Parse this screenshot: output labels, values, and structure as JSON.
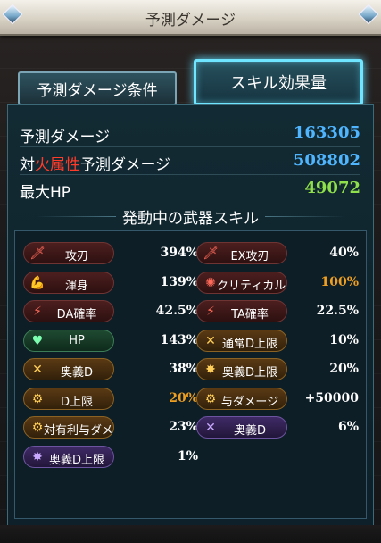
{
  "header": {
    "title": "予測ダメージ"
  },
  "tabs": [
    {
      "label": "予測ダメージ条件",
      "active": false
    },
    {
      "label": "スキル効果量",
      "active": true
    }
  ],
  "stats": {
    "predicted_damage": {
      "label": "予測ダメージ",
      "value": "163305",
      "color": "#4fb5ff"
    },
    "fire_damage": {
      "prefix": "対",
      "element": "火属性",
      "suffix": "予測ダメージ",
      "value": "508802",
      "color": "#4fb5ff"
    },
    "max_hp": {
      "label": "最大HP",
      "value": "49072",
      "color": "#8fe04a"
    }
  },
  "section_title": "発動中の武器スキル",
  "skills_left": [
    {
      "name": "攻刃",
      "value": "394%",
      "style": "red",
      "icon": "sword-icon",
      "glyph": "🗡"
    },
    {
      "name": "渾身",
      "value": "139%",
      "style": "red",
      "icon": "muscle-icon",
      "glyph": "💪"
    },
    {
      "name": "DA確率",
      "value": "42.5%",
      "style": "red",
      "icon": "double-slash-icon",
      "glyph": "⚡"
    },
    {
      "name": "HP",
      "value": "143%",
      "style": "green",
      "icon": "heart-icon",
      "glyph": "♥"
    },
    {
      "name": "奥義D",
      "value": "38%",
      "style": "orange",
      "icon": "crossed-swords-icon",
      "glyph": "✕"
    },
    {
      "name": "D上限",
      "value": "20%",
      "style": "orange",
      "icon": "gear-icon",
      "glyph": "⚙",
      "value_color": "orange"
    },
    {
      "name": "対有利与ダメ",
      "value": "23%",
      "style": "orange",
      "icon": "gear-icon",
      "glyph": "⚙"
    },
    {
      "name": "奥義D上限",
      "value": "1%",
      "style": "purple",
      "icon": "burst-icon",
      "glyph": "✸"
    }
  ],
  "skills_right": [
    {
      "name": "EX攻刃",
      "value": "40%",
      "style": "red",
      "icon": "sword-icon",
      "glyph": "🗡"
    },
    {
      "name": "クリティカル",
      "value": "100%",
      "style": "red",
      "icon": "crit-star-icon",
      "glyph": "✺",
      "value_color": "orange"
    },
    {
      "name": "TA確率",
      "value": "22.5%",
      "style": "red",
      "icon": "triple-slash-icon",
      "glyph": "⚡"
    },
    {
      "name": "通常D上限",
      "value": "10%",
      "style": "orange",
      "icon": "crossed-swords-icon",
      "glyph": "✕"
    },
    {
      "name": "奥義D上限",
      "value": "20%",
      "style": "orange",
      "icon": "burst-icon",
      "glyph": "✸"
    },
    {
      "name": "与ダメージ",
      "value": "+50000",
      "style": "orange",
      "icon": "gear-icon",
      "glyph": "⚙"
    },
    {
      "name": "奥義D",
      "value": "6%",
      "style": "purple",
      "icon": "crossed-swords-icon",
      "glyph": "✕"
    }
  ]
}
